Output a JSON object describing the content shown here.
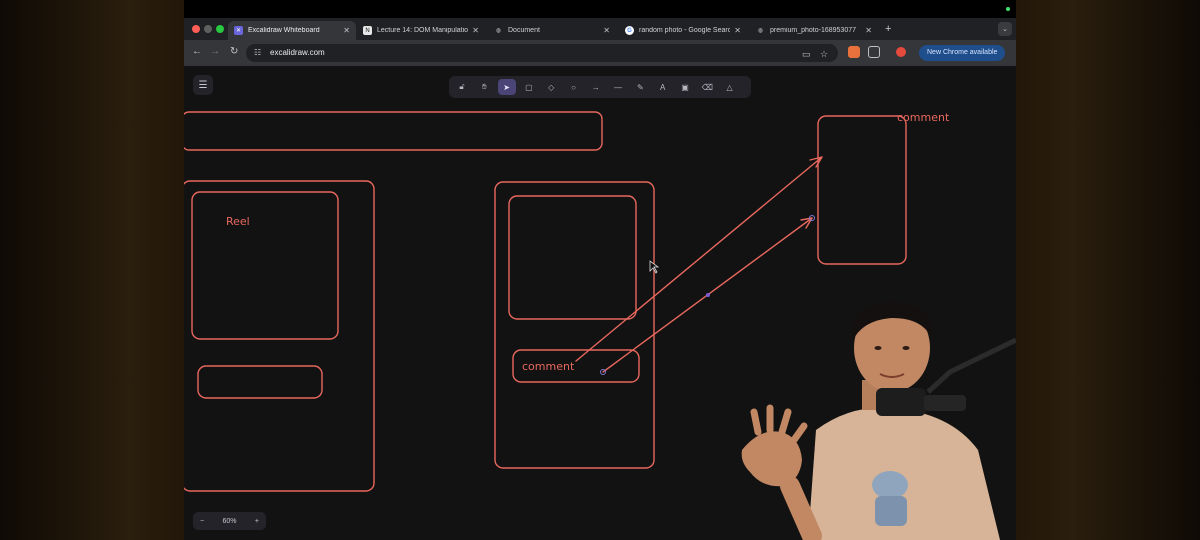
{
  "browser": {
    "tabs": [
      {
        "title": "Excalidraw Whiteboard",
        "active": true,
        "icon": "excalidraw-icon"
      },
      {
        "title": "Lecture 14: DOM Manipulatio",
        "active": false,
        "icon": "notion-icon"
      },
      {
        "title": "Document",
        "active": false,
        "icon": "globe-icon"
      },
      {
        "title": "random photo - Google Searc",
        "active": false,
        "icon": "google-icon"
      },
      {
        "title": "premium_photo-168953077",
        "active": false,
        "icon": "globe-icon"
      }
    ],
    "new_tab_symbol": "+",
    "url": "excalidraw.com",
    "update_button": "New Chrome available"
  },
  "excalidraw": {
    "tools": [
      "lock-icon",
      "hand-icon",
      "selection-icon",
      "rectangle-icon",
      "diamond-icon",
      "ellipse-icon",
      "arrow-icon",
      "line-icon",
      "pencil-icon",
      "text-icon",
      "image-icon",
      "eraser-icon",
      "library-icon"
    ],
    "active_tool": "selection-icon",
    "zoom": {
      "minus": "−",
      "value": "60%",
      "plus": "+"
    },
    "canvas_labels": {
      "reel": "Reel",
      "comment_left": "comment",
      "comment_right": "comment"
    },
    "stroke_color": "#e8685e"
  },
  "colors": {
    "accent_tool": "#4a4576",
    "stroke": "#e8685e",
    "canvas_bg": "#121212"
  }
}
